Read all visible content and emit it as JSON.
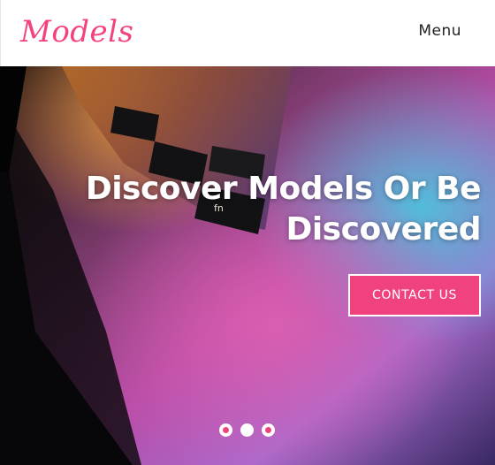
{
  "header": {
    "logo_text": "Models",
    "menu_label": "Menu"
  },
  "hero": {
    "headline_line1": "Discover Models Or Be",
    "headline_line2": "Discovered",
    "cta_label": "CONTACT US",
    "image_key_labels": [
      "fn"
    ]
  },
  "carousel": {
    "slide_count": 3,
    "active_index": 1
  },
  "colors": {
    "brand": "#f0427f",
    "header_bg": "#ffffff",
    "hero_bg": "#050507"
  }
}
